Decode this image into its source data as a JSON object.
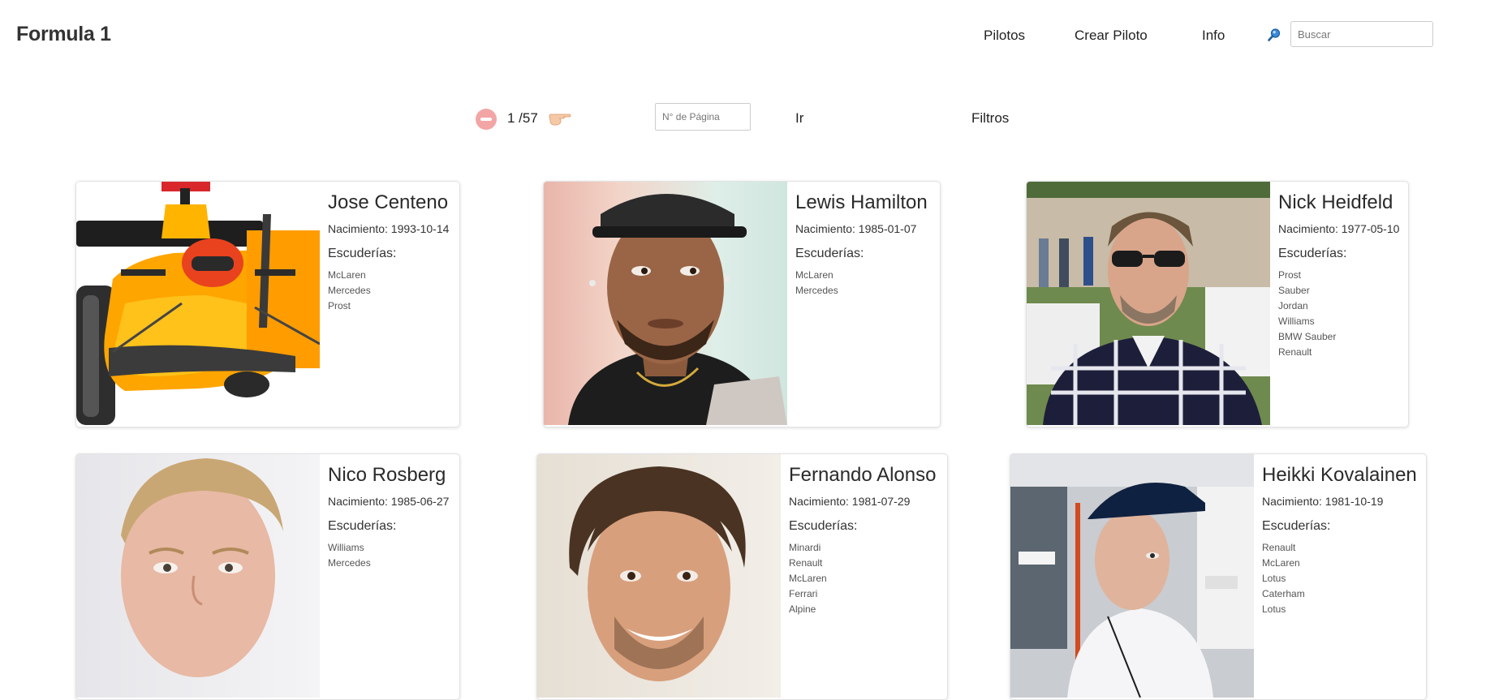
{
  "header": {
    "brand": "Formula 1",
    "nav": [
      "Pilotos",
      "Crear Piloto",
      "Info"
    ],
    "search_placeholder": "Buscar"
  },
  "pager": {
    "indicator": "1 /57",
    "page_input_placeholder": "N° de Página",
    "go_label": "Ir",
    "filters_label": "Filtros"
  },
  "drivers": [
    {
      "name": "Jose Centeno",
      "birth": "Nacimiento: 1993-10-14",
      "teams_title": "Escuderías:",
      "teams": [
        "McLaren",
        "Mercedes",
        "Prost"
      ]
    },
    {
      "name": "Lewis Hamilton",
      "birth": "Nacimiento: 1985-01-07",
      "teams_title": "Escuderías:",
      "teams": [
        "McLaren",
        "Mercedes"
      ]
    },
    {
      "name": "Nick Heidfeld",
      "birth": "Nacimiento: 1977-05-10",
      "teams_title": "Escuderías:",
      "teams": [
        "Prost",
        "Sauber",
        "Jordan",
        "Williams",
        "BMW Sauber",
        "Renault"
      ]
    },
    {
      "name": "Nico Rosberg",
      "birth": "Nacimiento: 1985-06-27",
      "teams_title": "Escuderías:",
      "teams": [
        "Williams",
        "Mercedes"
      ]
    },
    {
      "name": "Fernando Alonso",
      "birth": "Nacimiento: 1981-07-29",
      "teams_title": "Escuderías:",
      "teams": [
        "Minardi",
        "Renault",
        "McLaren",
        "Ferrari",
        "Alpine"
      ]
    },
    {
      "name": "Heikki Kovalainen",
      "birth": "Nacimiento: 1981-10-19",
      "teams_title": "Escuderías:",
      "teams": [
        "Renault",
        "McLaren",
        "Lotus",
        "Caterham",
        "Lotus"
      ]
    }
  ],
  "colors": {
    "prev_icon": "#f3a5a5",
    "card_border": "#e2e2e2"
  },
  "icons": {
    "search": "search-icon",
    "prev": "minus-circle-icon",
    "next": "pointing-hand-icon"
  }
}
